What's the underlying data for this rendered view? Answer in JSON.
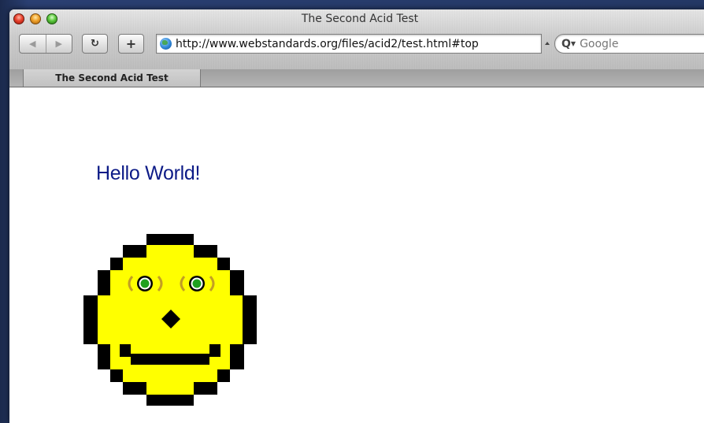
{
  "window": {
    "title": "The Second Acid Test"
  },
  "toolbar": {
    "back_glyph": "◀",
    "forward_glyph": "▶",
    "reload_glyph": "↻",
    "add_bookmark_glyph": "+",
    "url": "http://www.webstandards.org/files/acid2/test.html#top",
    "search_placeholder": "Google",
    "search_icon_glyph": "Q",
    "search_caret_glyph": "▼"
  },
  "tabs": [
    {
      "label": "The Second Acid Test",
      "active": true
    }
  ],
  "page": {
    "heading": "Hello World!",
    "heading_color": "#0d1b87",
    "smiley_face_color": "#ffff00",
    "smiley_outline_color": "#000000",
    "smiley_eye_color": "#1fa01f"
  },
  "colors": {
    "close": "#e8412d",
    "minimize": "#f0a12a",
    "zoom": "#5cc83e"
  }
}
